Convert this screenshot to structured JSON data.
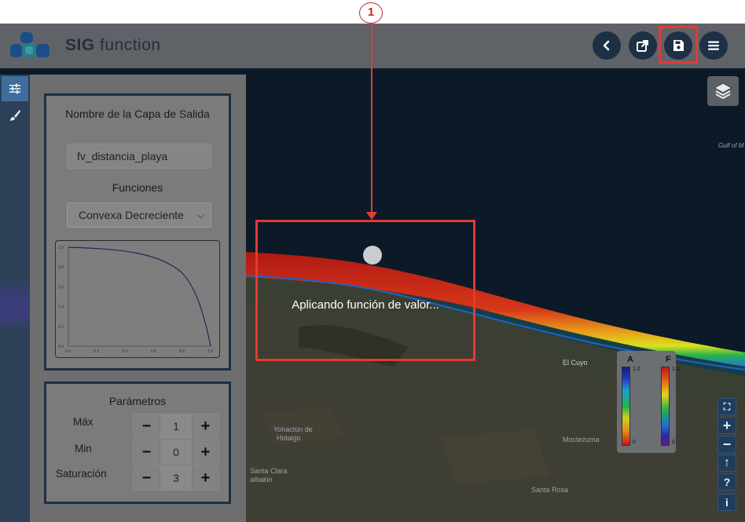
{
  "annotation": {
    "callout_number": "1"
  },
  "header": {
    "brand_prefix": "SIG",
    "brand_suffix": "function",
    "buttons": [
      {
        "name": "back",
        "icon": "chevron-left-icon"
      },
      {
        "name": "export",
        "icon": "share-icon"
      },
      {
        "name": "save",
        "icon": "floppy-disk-icon"
      },
      {
        "name": "menu",
        "icon": "hamburger-menu-icon"
      }
    ]
  },
  "sidebar": {
    "tabs": [
      {
        "name": "parameters",
        "icon": "sliders-icon",
        "active": true
      },
      {
        "name": "style",
        "icon": "paintbrush-icon",
        "active": false
      }
    ]
  },
  "panel": {
    "output_layer_label": "Nombre de la Capa de Salida",
    "output_layer_value": "fv_distancia_playa",
    "functions_label": "Funciones",
    "function_selected": "Convexa Decreciente",
    "plot": {
      "y_ticks": [
        "1.0",
        "0.8",
        "0.6",
        "0.4",
        "0.2",
        "0.0"
      ],
      "x_ticks": [
        "0.0",
        "0.2",
        "0.4",
        "0.6",
        "0.8",
        "1.0"
      ]
    },
    "parameters_title": "Parámetros",
    "parameters": [
      {
        "label": "Máx",
        "value": "1",
        "minus": "−",
        "plus": "+"
      },
      {
        "label": "Min",
        "value": "0",
        "minus": "−",
        "plus": "+"
      },
      {
        "label": "Saturación",
        "value": "3",
        "minus": "−",
        "plus": "+"
      }
    ]
  },
  "loading": {
    "message": "Aplicando función de valor..."
  },
  "map": {
    "labels": {
      "gulf": "Gulf of M",
      "el_cuyo": "El Cuyo",
      "yohactun": "Yohactún de",
      "hidalgo": "Hidalgo",
      "moctezuma": "Moctezuma",
      "santa_clara": "Santa Clara",
      "balkin": "albakin",
      "santa_rosa": "Santa Rosa"
    }
  },
  "legend": {
    "a_label": "A",
    "f_label": "F",
    "a_max": "1.0",
    "a_min": "0",
    "f_max": "1.0",
    "f_min": "0",
    "colors": {
      "a_top": "#1a1a7a",
      "a_bottom": "#c01818",
      "f_top": "#c01818",
      "f_bottom": "#5a1a8a"
    }
  },
  "map_controls": {
    "fullscreen": "⛶",
    "zoom_in": "+",
    "zoom_out": "−",
    "north": "↑",
    "help": "?",
    "info": "i"
  },
  "theme": {
    "accent": "#1d3045",
    "highlight": "#e53935"
  }
}
